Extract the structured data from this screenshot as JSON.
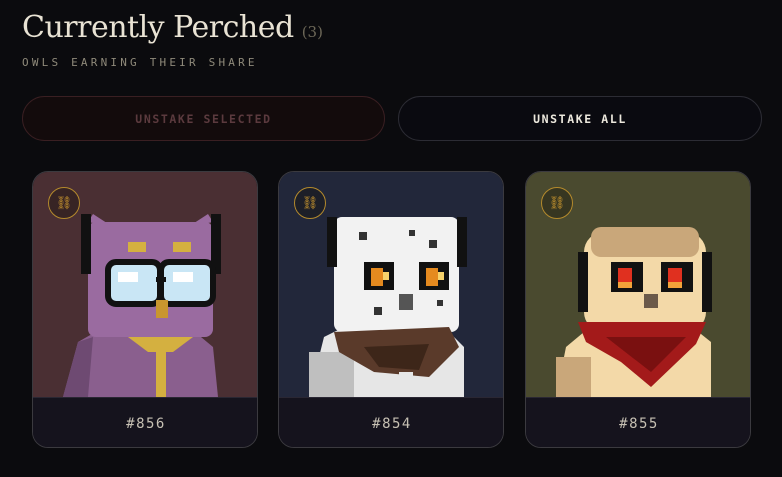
{
  "header": {
    "title": "Currently Perched",
    "count": "(3)",
    "subtitle": "OWLS EARNING THEIR SHARE"
  },
  "actions": {
    "unstake_selected_label": "UNSTAKE SELECTED",
    "unstake_all_label": "UNSTAKE ALL"
  },
  "cards": [
    {
      "id": "#856",
      "bg_color": "#4a2f33",
      "badge_icon": "⛓",
      "owl": "purple owl with glasses and gold necklace"
    },
    {
      "id": "#854",
      "bg_color": "#22273a",
      "badge_icon": "⛓",
      "owl": "white spotted owl with brown scarf"
    },
    {
      "id": "#855",
      "bg_color": "#4a4a2f",
      "badge_icon": "⛓",
      "owl": "cream owl with red bandana"
    }
  ],
  "colors": {
    "background": "#0b0b0e",
    "accent_gold": "#c9962e",
    "text_primary": "#e9e3d4"
  }
}
